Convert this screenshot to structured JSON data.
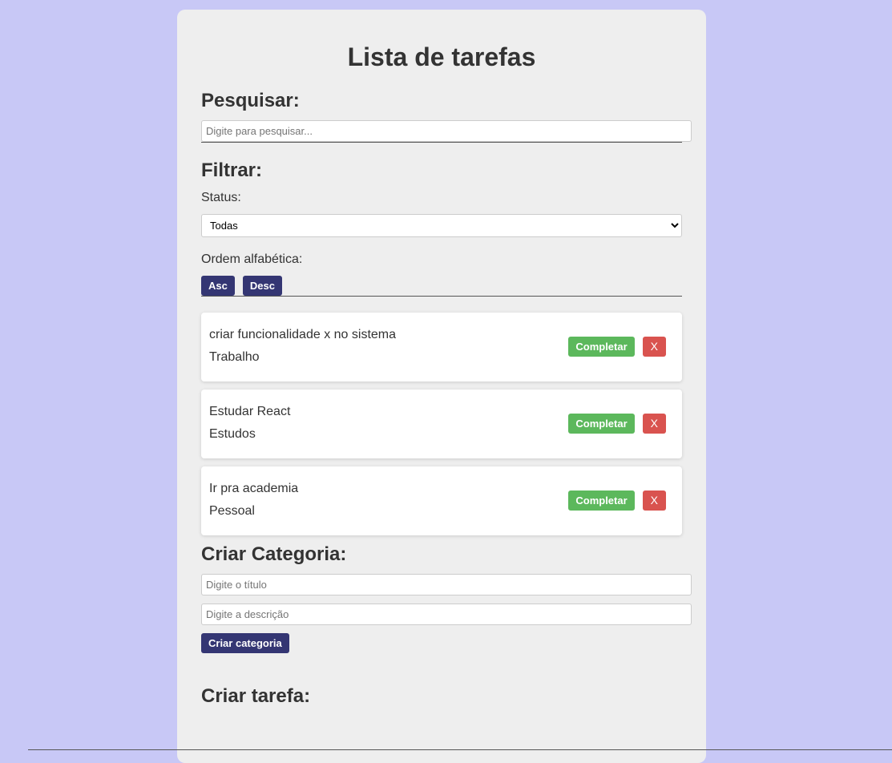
{
  "page": {
    "title": "Lista de tarefas"
  },
  "search": {
    "heading": "Pesquisar:",
    "placeholder": "Digite para pesquisar..."
  },
  "filter": {
    "heading": "Filtrar:",
    "status_label": "Status:",
    "status_selected": "Todas",
    "order_label": "Ordem alfabética:",
    "asc_label": "Asc",
    "desc_label": "Desc"
  },
  "todos": [
    {
      "text": "criar funcionalidade x no sistema",
      "category": "Trabalho",
      "complete_label": "Completar",
      "remove_label": "X"
    },
    {
      "text": "Estudar React",
      "category": "Estudos",
      "complete_label": "Completar",
      "remove_label": "X"
    },
    {
      "text": "Ir pra academia",
      "category": "Pessoal",
      "complete_label": "Completar",
      "remove_label": "X"
    }
  ],
  "create_category": {
    "heading": "Criar Categoria:",
    "title_placeholder": "Digite o título",
    "description_placeholder": "Digite a descrição",
    "button_label": "Criar categoria"
  },
  "create_task": {
    "heading": "Criar tarefa:"
  },
  "colors": {
    "background": "#c8c8f6",
    "panel": "#eeeeee",
    "primary_button": "#343673",
    "complete_button": "#5cb85c",
    "remove_button": "#d9534f"
  }
}
